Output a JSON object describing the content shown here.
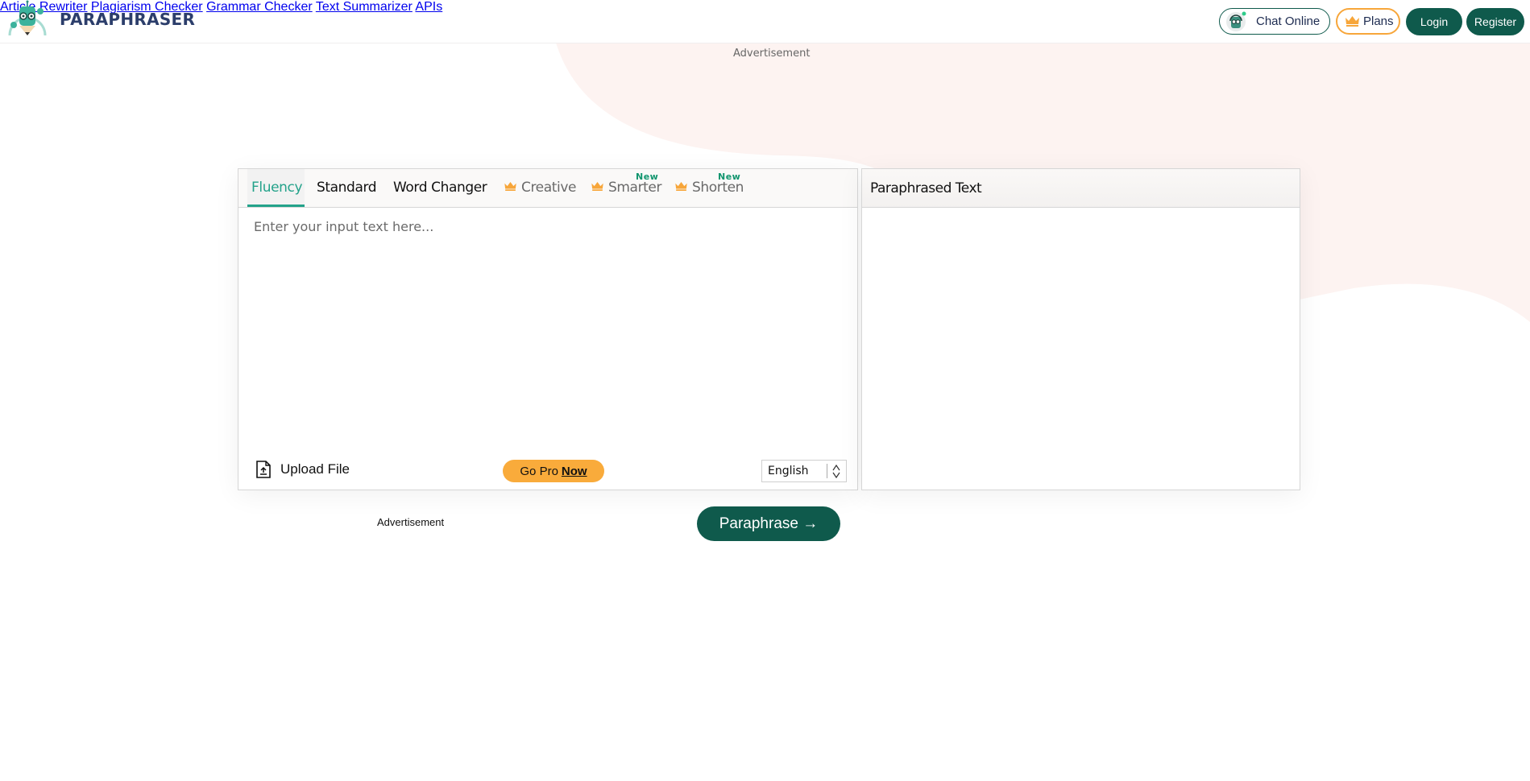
{
  "header": {
    "brand": "PARAPHRASER",
    "nav": [
      {
        "label": "Article Rewriter"
      },
      {
        "label": "Plagiarism Checker"
      },
      {
        "label": "Grammar Checker"
      },
      {
        "label": "Text Summarizer"
      },
      {
        "label": "APIs"
      }
    ],
    "chat_label": "Chat Online",
    "plans_label": "Plans",
    "login_label": "Login",
    "register_label": "Register"
  },
  "ads": {
    "top": "Advertisement",
    "bottom": "Advertisement"
  },
  "editor": {
    "tabs": [
      {
        "label": "Fluency",
        "active": true,
        "locked": false
      },
      {
        "label": "Standard",
        "active": false,
        "locked": false
      },
      {
        "label": "Word Changer",
        "active": false,
        "locked": false
      },
      {
        "label": "Creative",
        "active": false,
        "locked": true
      },
      {
        "label": "Smarter",
        "active": false,
        "locked": true,
        "badge": "New"
      },
      {
        "label": "Shorten",
        "active": false,
        "locked": true,
        "badge": "New"
      }
    ],
    "input_placeholder": "Enter your input text here...",
    "input_value": "",
    "upload_label": "Upload File",
    "gopro_label": "Go Pro",
    "gopro_emphasis": "Now",
    "language": "English"
  },
  "output": {
    "title": "Paraphrased Text",
    "value": ""
  },
  "paraphrase_button": "Paraphrase →",
  "colors": {
    "brand_green": "#0f5a4c",
    "accent_teal": "#23a28a",
    "accent_orange": "#f9ab3b",
    "brand_navy": "#2c3e6b"
  }
}
